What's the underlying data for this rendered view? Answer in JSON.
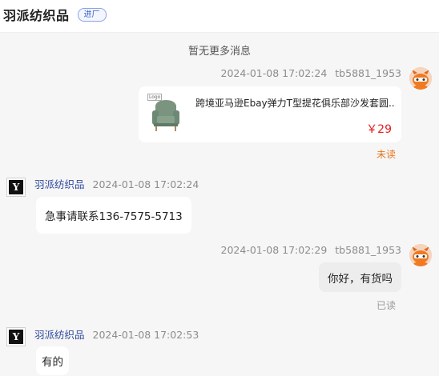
{
  "header": {
    "title": "羽派纺织品",
    "badge": "进厂"
  },
  "chat": {
    "no_more_label": "暂无更多消息",
    "messages": [
      {
        "side": "right",
        "time": "2024-01-08 17:02:24",
        "sender": "tb5881_1953",
        "product": {
          "title": "跨境亚马逊Ebay弹力T型提花俱乐部沙发套圆...",
          "price": "￥29",
          "thumb_tag": "Logo"
        },
        "status": "未读"
      },
      {
        "side": "left",
        "sender": "羽派纺织品",
        "time": "2024-01-08 17:02:24",
        "text": "急事请联系136-7575-5713"
      },
      {
        "side": "right",
        "time": "2024-01-08 17:02:29",
        "sender": "tb5881_1953",
        "text": "你好，有货吗",
        "status": "已读"
      },
      {
        "side": "left",
        "sender": "羽派纺织品",
        "time": "2024-01-08 17:02:53",
        "text": "有的"
      }
    ]
  },
  "colors": {
    "unread": "#e87722",
    "read": "#999999",
    "price": "#e02020",
    "sender_name": "#2f4a9e"
  },
  "icons": {
    "customer_avatar": "cartoon-avatar-icon",
    "shop_avatar": "shop-logo-icon",
    "product_thumbnail": "armchair-icon"
  }
}
